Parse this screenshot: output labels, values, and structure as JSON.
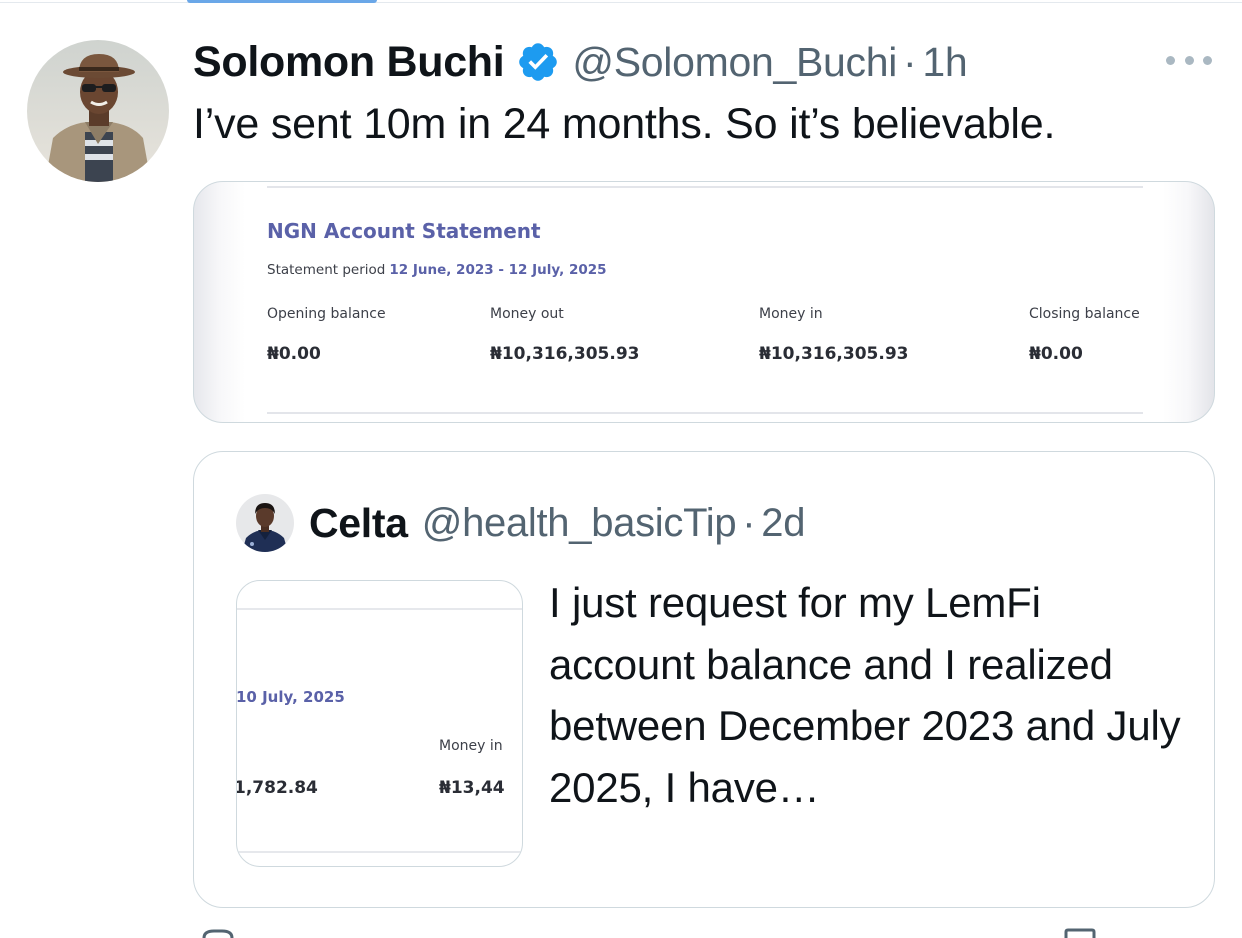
{
  "tweet": {
    "author": {
      "name": "Solomon Buchi",
      "handle": "@Solomon_Buchi",
      "time": "1h",
      "separator": "·"
    },
    "text": "I’ve sent 10m in 24 months. So it’s believable.",
    "statement": {
      "title": "NGN Account Statement",
      "period_label": "Statement period",
      "period_value": "12 June, 2023 - 12 July, 2025",
      "columns": [
        {
          "label": "Opening balance",
          "value": "₦0.00"
        },
        {
          "label": "Money out",
          "value": "₦10,316,305.93"
        },
        {
          "label": "Money in",
          "value": "₦10,316,305.93"
        },
        {
          "label": "Closing balance",
          "value": "₦0.00"
        }
      ]
    }
  },
  "quote": {
    "author": {
      "name": "Celta",
      "handle": "@health_basicTip",
      "time": "2d",
      "separator": "·"
    },
    "text": "I just request for my LemFi account balance and I realized between December 2023 and July 2025, I have…",
    "thumbnail": {
      "date": "10 July, 2025",
      "money_in_label": "Money in",
      "value_left": "1,782.84",
      "value_right": "₦13,44"
    }
  },
  "colors": {
    "verified": "#1d9bf0",
    "statement_accent": "#5a61a8",
    "secondary_text": "#536471"
  }
}
